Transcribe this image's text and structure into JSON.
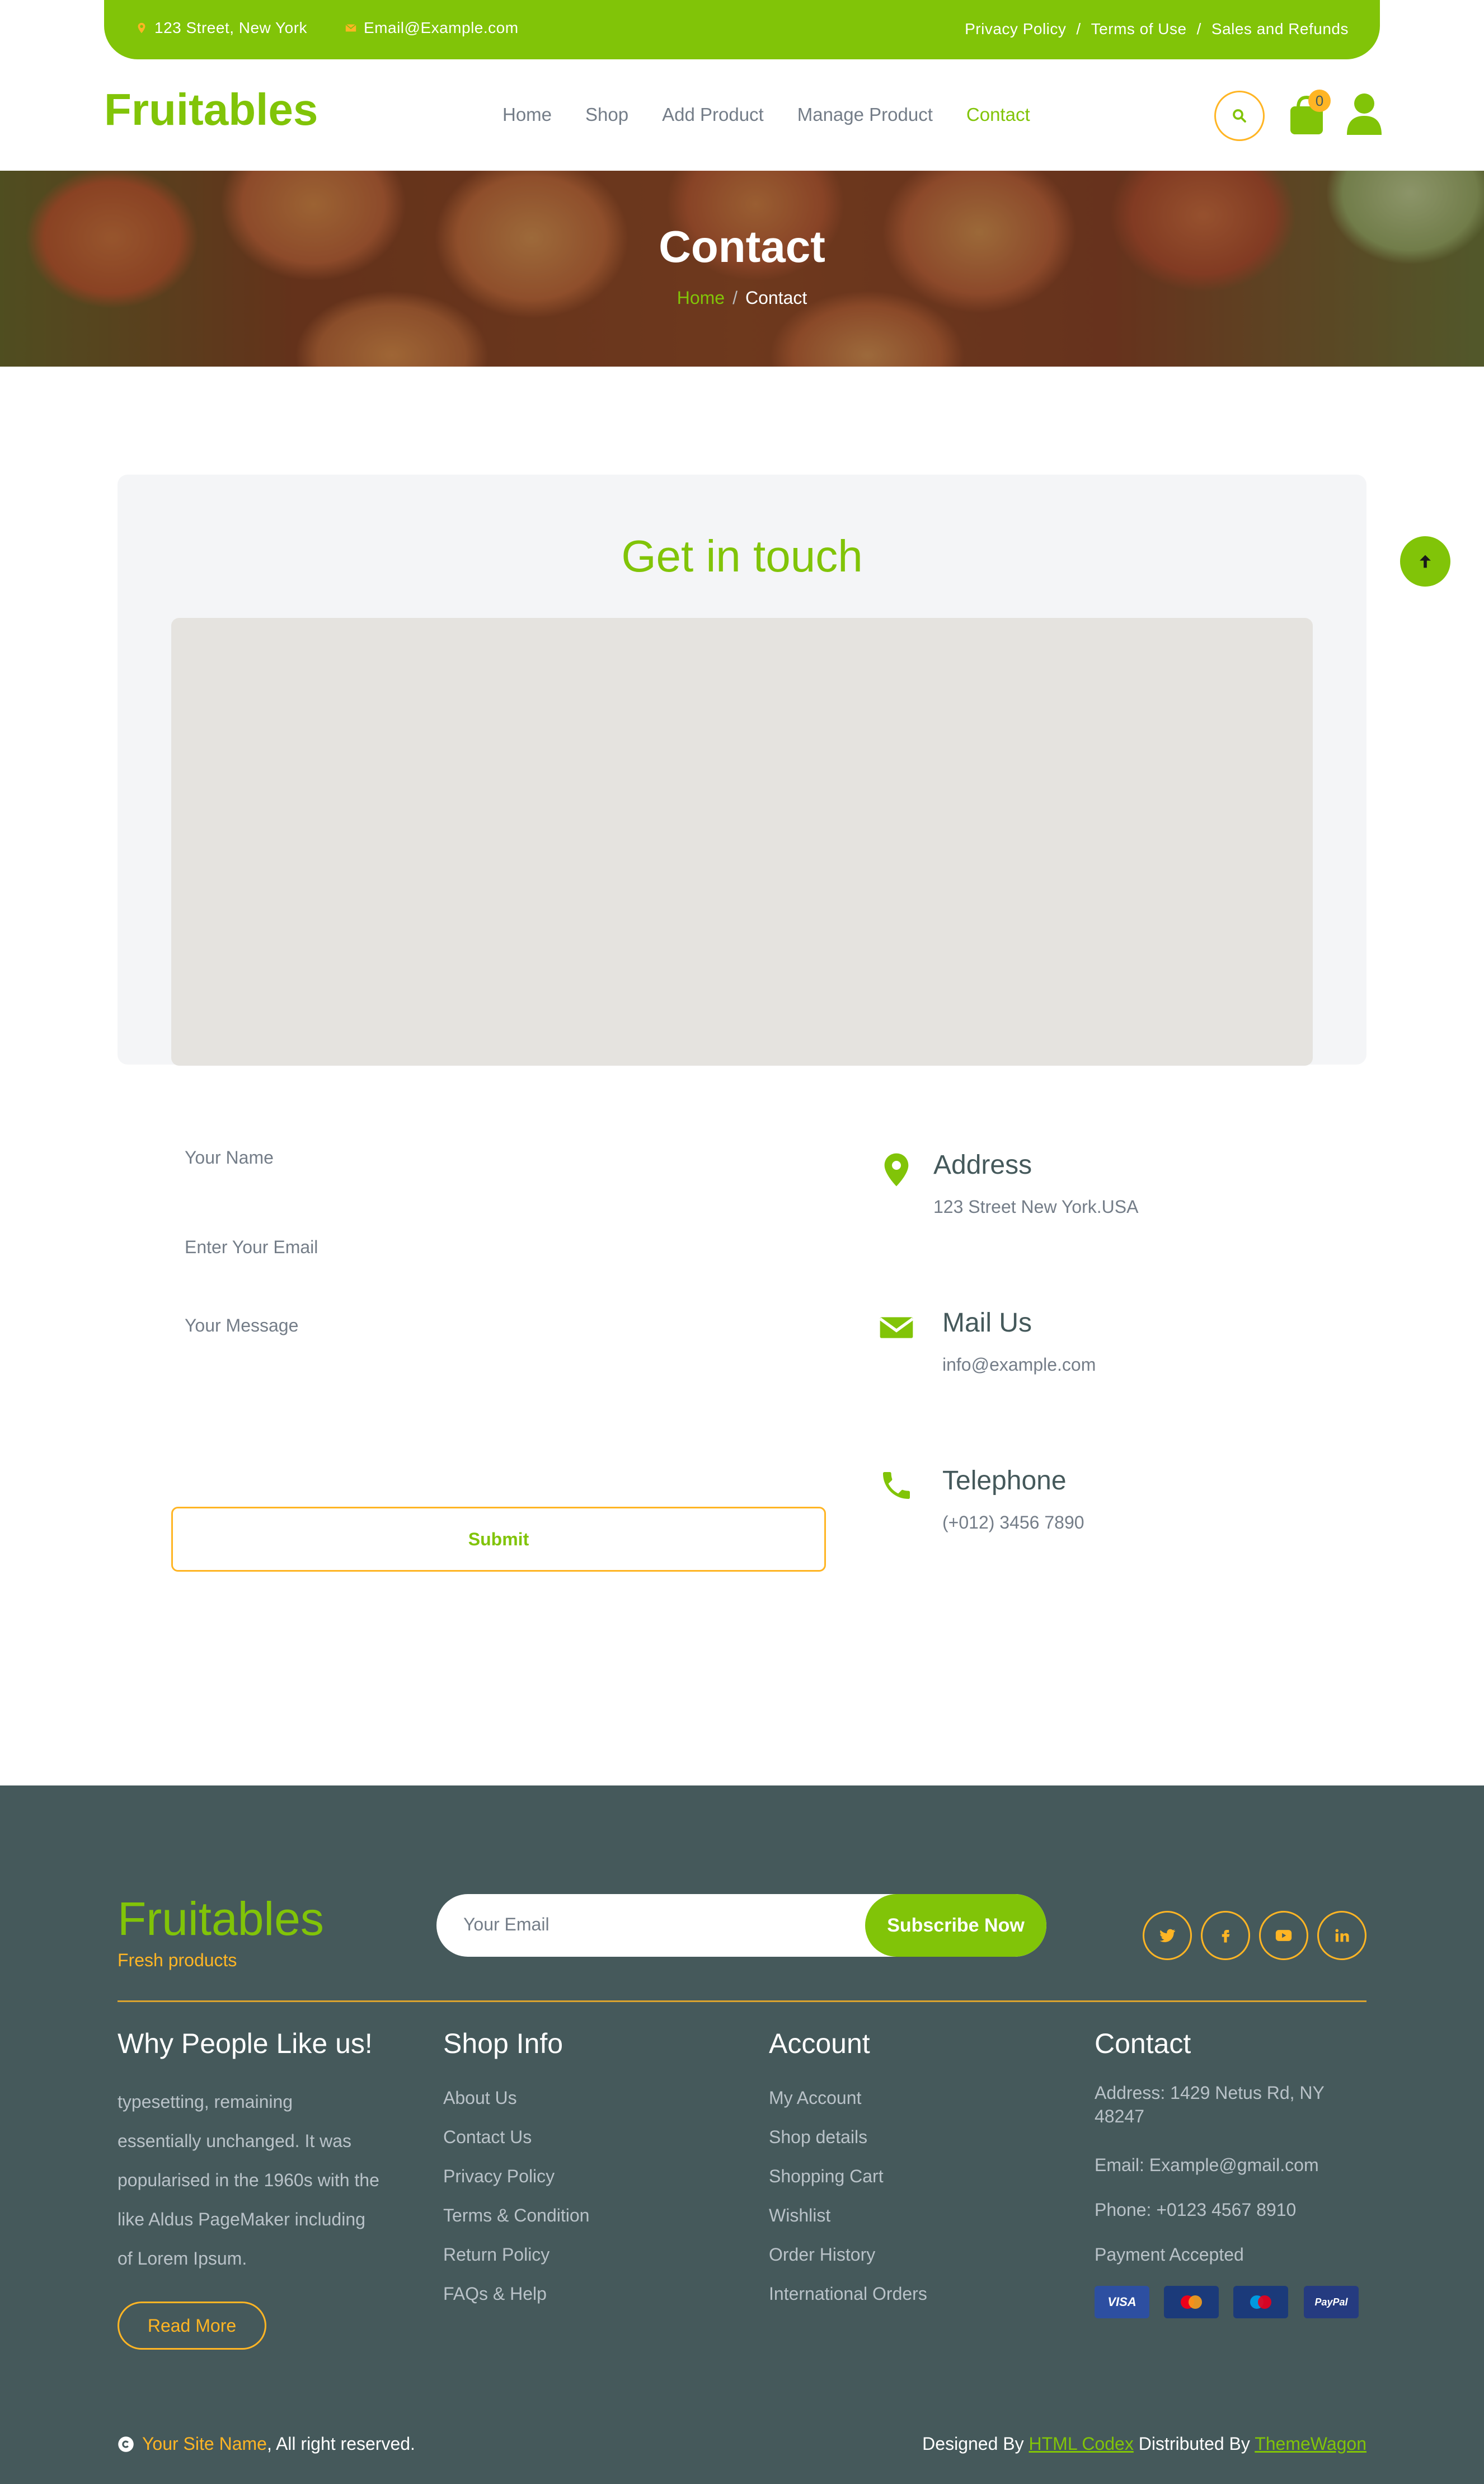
{
  "topbar": {
    "address": "123 Street, New York",
    "email": "Email@Example.com",
    "links": [
      "Privacy Policy",
      "/",
      "Terms of Use",
      "/",
      "Sales and Refunds"
    ]
  },
  "brand": "Fruitables",
  "nav": {
    "items": [
      "Home",
      "Shop",
      "Add Product",
      "Manage Product",
      "Contact"
    ],
    "active": "Contact",
    "cart_count": "0"
  },
  "hero": {
    "title": "Contact",
    "breadcrumb_home": "Home",
    "breadcrumb_sep": "/",
    "breadcrumb_current": "Contact"
  },
  "contact": {
    "heading": "Get in touch",
    "name_placeholder": "Your Name",
    "email_placeholder": "Enter Your Email",
    "message_placeholder": "Your Message",
    "submit_label": "Submit",
    "cards": [
      {
        "title": "Address",
        "value": "123 Street New York.USA",
        "icon": "map-marker-icon"
      },
      {
        "title": "Mail Us",
        "value": "info@example.com",
        "icon": "envelope-icon"
      },
      {
        "title": "Telephone",
        "value": "(+012) 3456 7890",
        "icon": "phone-icon"
      }
    ]
  },
  "footer": {
    "brand": "Fruitables",
    "tagline": "Fresh products",
    "subscribe_placeholder": "Your Email",
    "subscribe_label": "Subscribe Now",
    "social": [
      "twitter-icon",
      "facebook-icon",
      "youtube-icon",
      "linkedin-icon"
    ],
    "why": {
      "title": "Why People Like us!",
      "text": "typesetting, remaining essentially unchanged. It was popularised in the 1960s with the like Aldus PageMaker including of Lorem Ipsum.",
      "read_more": "Read More"
    },
    "shop_info": {
      "title": "Shop Info",
      "links": [
        "About Us",
        "Contact Us",
        "Privacy Policy",
        "Terms & Condition",
        "Return Policy",
        "FAQs & Help"
      ]
    },
    "account": {
      "title": "Account",
      "links": [
        "My Account",
        "Shop details",
        "Shopping Cart",
        "Wishlist",
        "Order History",
        "International Orders"
      ]
    },
    "contact": {
      "title": "Contact",
      "address": "Address: 1429 Netus Rd, NY 48247",
      "email": "Email: Example@gmail.com",
      "phone": "Phone: +0123 4567 8910",
      "payment": "Payment Accepted",
      "cards": [
        "VISA",
        "MasterCard",
        "Maestro",
        "PayPal"
      ]
    },
    "copyright_site": "Your Site Name",
    "copyright_rest": ", All right reserved.",
    "designed_by_prefix": "Designed By",
    "designed_by": "HTML Codex",
    "distributed_by_prefix": "Distributed By",
    "distributed_by": "ThemeWagon"
  },
  "colors": {
    "primary": "#81c408",
    "secondary": "#ffb524",
    "dark": "#45595b",
    "panel": "#f4f5f7",
    "map": "#e5e3df"
  }
}
